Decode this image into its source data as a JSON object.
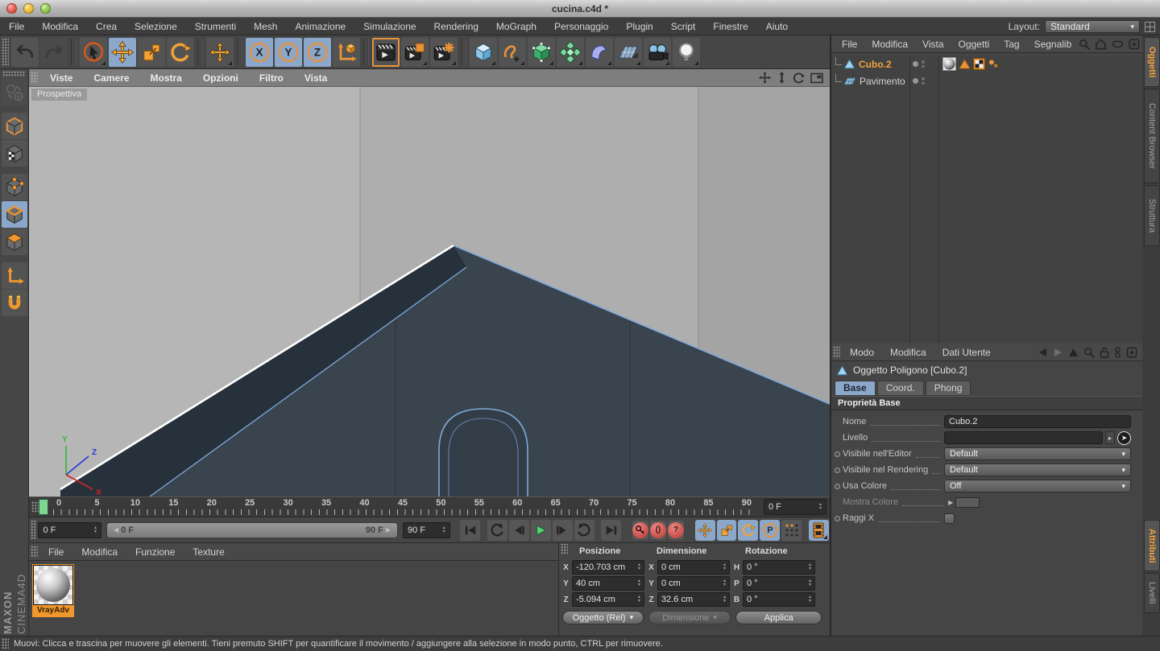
{
  "window": {
    "title": "cucina.c4d *"
  },
  "menubar": {
    "items": [
      "File",
      "Modifica",
      "Crea",
      "Selezione",
      "Strumenti",
      "Mesh",
      "Animazione",
      "Simulazione",
      "Rendering",
      "MoGraph",
      "Personaggio",
      "Plugin",
      "Script",
      "Finestre",
      "Aiuto"
    ],
    "layout_label": "Layout:",
    "layout_value": "Standard"
  },
  "toolbar": {
    "x_label": "X",
    "y_label": "Y",
    "z_label": "Z"
  },
  "viewport": {
    "menus": [
      "Viste",
      "Camere",
      "Mostra",
      "Opzioni",
      "Filtro",
      "Vista"
    ],
    "camera_label": "Prospettiva",
    "axis_x": "X",
    "axis_y": "Y",
    "axis_z": "Z"
  },
  "timeline": {
    "ticks": [
      "0",
      "5",
      "10",
      "15",
      "20",
      "25",
      "30",
      "35",
      "40",
      "45",
      "50",
      "55",
      "60",
      "65",
      "70",
      "75",
      "80",
      "85",
      "90"
    ],
    "current_frame": "0 F",
    "frame_spinner": "0 F",
    "range_start": "0 F",
    "range_end": "90 F",
    "end_frame": "90 F"
  },
  "anim": {
    "parens_label": "()",
    "question_label": "?",
    "p_label": "P"
  },
  "materials": {
    "menus": [
      "File",
      "Modifica",
      "Funzione",
      "Texture"
    ],
    "items": [
      {
        "name": "VrayAdv"
      }
    ]
  },
  "coordinates": {
    "columns": [
      {
        "title": "Posizione",
        "rows": [
          {
            "axis": "X",
            "value": "-120.703 cm"
          },
          {
            "axis": "Y",
            "value": "40 cm"
          },
          {
            "axis": "Z",
            "value": "-5.094 cm"
          }
        ],
        "footer": "Oggetto (Rel)"
      },
      {
        "title": "Dimensione",
        "rows": [
          {
            "axis": "X",
            "value": "0 cm"
          },
          {
            "axis": "Y",
            "value": "0 cm"
          },
          {
            "axis": "Z",
            "value": "32.6 cm"
          }
        ],
        "footer": "Dimensione"
      },
      {
        "title": "Rotazione",
        "rows": [
          {
            "axis": "H",
            "value": "0 °"
          },
          {
            "axis": "P",
            "value": "0 °"
          },
          {
            "axis": "B",
            "value": "0 °"
          }
        ],
        "footer": "Applica"
      }
    ]
  },
  "object_manager": {
    "menus": [
      "File",
      "Modifica",
      "Vista",
      "Oggetti",
      "Tag",
      "Segnalib"
    ],
    "objects": [
      {
        "name": "Cubo.2"
      },
      {
        "name": "Pavimento"
      }
    ]
  },
  "attributes": {
    "menus": [
      "Modo",
      "Modifica",
      "Dati Utente"
    ],
    "title": "Oggetto Poligono [Cubo.2]",
    "tabs": {
      "base": "Base",
      "coord": "Coord.",
      "phong": "Phong"
    },
    "section": "Proprietà Base",
    "fields": {
      "nome_label": "Nome",
      "nome_value": "Cubo.2",
      "livello_label": "Livello",
      "vis_editor_label": "Visibile nell'Editor",
      "vis_editor_value": "Default",
      "vis_render_label": "Visibile nel Rendering",
      "vis_render_value": "Default",
      "usa_colore_label": "Usa Colore",
      "usa_colore_value": "Off",
      "mostra_colore_label": "Mostra Colore",
      "raggi_x_label": "Raggi X"
    }
  },
  "side_tabs": {
    "oggetti": "Oggetti",
    "content_browser": "Content Browser",
    "struttura": "Struttura",
    "attributi": "Attributi",
    "livelli": "Livelli"
  },
  "status_bar": {
    "text": "Muovi: Clicca e trascina per muovere gli elementi. Tieni premuto SHIFT per quantificare il movimento / aggiungere alla selezione in modo punto, CTRL per rimuovere."
  },
  "branding": {
    "line1": "MAXON",
    "line2": "CINEMA4D"
  },
  "icons": {
    "caret_down": "▾",
    "spin_up": "▴",
    "spin_down": "▾",
    "arrow_left": "◀",
    "arrow_right": "▶",
    "arrow_small": "▸"
  },
  "colors": {
    "accent_orange": "#f0982e",
    "selection_blue": "#8ba7ca",
    "selected_text": "#f2a33c",
    "viewport_bg": "#b0b0b0",
    "surface_dark": "#39444f",
    "edge_blue": "#7fa8d8",
    "edge_selected": "#ffffff",
    "record_red": "#cf5a55",
    "play_green": "#52d273",
    "marker_green": "#7ed491"
  }
}
